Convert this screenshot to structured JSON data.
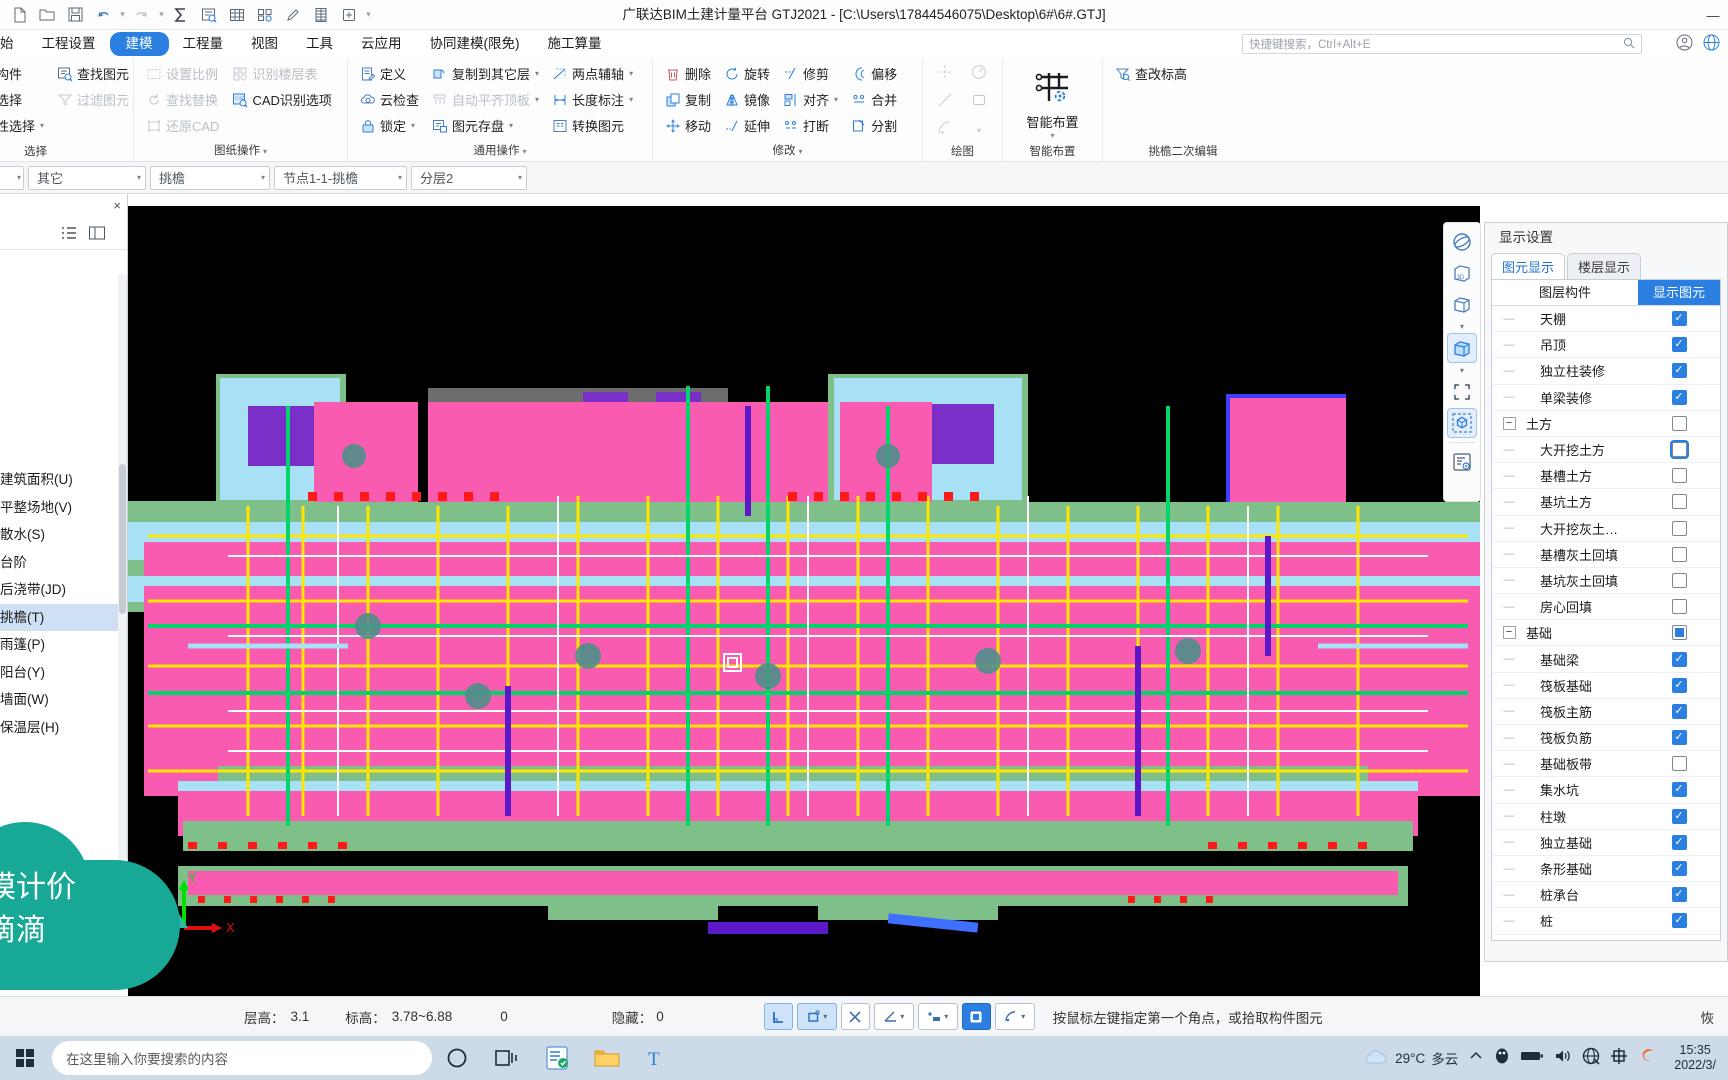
{
  "window": {
    "title": "广联达BIM土建计量平台 GTJ2021 - [C:\\Users\\17844546075\\Desktop\\6#\\6#.GTJ]",
    "minimize": "—",
    "maximize": "▢",
    "close": "✕"
  },
  "quick_access": [
    {
      "name": "new-file-icon",
      "glyph": "new"
    },
    {
      "name": "open-folder-icon",
      "glyph": "open"
    },
    {
      "name": "save-icon",
      "glyph": "save"
    },
    {
      "name": "undo-icon",
      "glyph": "undo"
    },
    {
      "name": "redo-icon",
      "glyph": "redo"
    },
    {
      "name": "sum-icon",
      "glyph": "sum"
    },
    {
      "name": "check-quantity-icon",
      "glyph": "qcheck"
    },
    {
      "name": "table-icon",
      "glyph": "table"
    },
    {
      "name": "report-icon",
      "glyph": "report"
    },
    {
      "name": "pen-icon",
      "glyph": "pen"
    },
    {
      "name": "ruler-icon",
      "glyph": "ruler"
    },
    {
      "name": "add-item-icon",
      "glyph": "additem"
    }
  ],
  "menubar": {
    "items": [
      {
        "label": "始",
        "active": false
      },
      {
        "label": "工程设置",
        "active": false
      },
      {
        "label": "建模",
        "active": true
      },
      {
        "label": "工程量",
        "active": false
      },
      {
        "label": "视图",
        "active": false
      },
      {
        "label": "工具",
        "active": false
      },
      {
        "label": "云应用",
        "active": false
      },
      {
        "label": "协同建模(限免)",
        "active": false
      },
      {
        "label": "施工算量",
        "active": false
      }
    ],
    "search_placeholder": "快捷键搜索，Ctrl+Alt+E"
  },
  "ribbon": {
    "groups": [
      {
        "title": "选择",
        "columns": [
          {
            "items": [
              {
                "label": "拾取构件",
                "icon": "pick-component-icon",
                "disabled": false,
                "caret": false
              },
              {
                "label": "批量选择",
                "icon": "batch-select-icon",
                "disabled": false,
                "caret": false
              },
              {
                "label": "按属性选择",
                "icon": "select-by-attribute-icon",
                "disabled": false,
                "caret": true
              }
            ]
          },
          {
            "items": [
              {
                "label": "查找图元",
                "icon": "find-element-icon",
                "disabled": false,
                "caret": false
              },
              {
                "label": "过滤图元",
                "icon": "filter-element-icon",
                "disabled": true,
                "caret": false
              }
            ]
          }
        ]
      },
      {
        "title": "图纸操作",
        "columns": [
          {
            "items": [
              {
                "label": "设置比例",
                "icon": "set-scale-icon",
                "disabled": true,
                "caret": false
              },
              {
                "label": "查找替换",
                "icon": "find-replace-icon",
                "disabled": true,
                "caret": false
              },
              {
                "label": "还原CAD",
                "icon": "restore-cad-icon",
                "disabled": true,
                "caret": false
              }
            ]
          },
          {
            "items": [
              {
                "label": "识别楼层表",
                "icon": "recognize-floor-table-icon",
                "disabled": true,
                "caret": false
              },
              {
                "label": "CAD识别选项",
                "icon": "cad-recognize-options-icon",
                "disabled": false,
                "caret": false
              }
            ]
          }
        ]
      },
      {
        "title": "通用操作",
        "columns": [
          {
            "items": [
              {
                "label": "定义",
                "icon": "define-icon",
                "disabled": false,
                "caret": false
              },
              {
                "label": "云检查",
                "icon": "cloud-check-icon",
                "disabled": false,
                "caret": false
              },
              {
                "label": "锁定",
                "icon": "lock-icon",
                "disabled": false,
                "caret": true
              }
            ]
          },
          {
            "items": [
              {
                "label": "复制到其它层",
                "icon": "copy-to-other-floor-icon",
                "disabled": false,
                "caret": true
              },
              {
                "label": "自动平齐顶板",
                "icon": "auto-align-slab-icon",
                "disabled": true,
                "caret": true
              },
              {
                "label": "图元存盘",
                "icon": "save-element-icon",
                "disabled": false,
                "caret": true
              }
            ]
          },
          {
            "items": [
              {
                "label": "两点辅轴",
                "icon": "two-point-aux-axis-icon",
                "disabled": false,
                "caret": true
              },
              {
                "label": "长度标注",
                "icon": "length-dimension-icon",
                "disabled": false,
                "caret": true
              },
              {
                "label": "转换图元",
                "icon": "convert-element-icon",
                "disabled": false,
                "caret": false
              }
            ]
          }
        ]
      },
      {
        "title": "修改",
        "columns": [
          {
            "items": [
              {
                "label": "删除",
                "icon": "delete-icon",
                "disabled": false,
                "caret": false
              },
              {
                "label": "复制",
                "icon": "copy-icon",
                "disabled": false,
                "caret": false
              },
              {
                "label": "移动",
                "icon": "move-icon",
                "disabled": false,
                "caret": false
              }
            ]
          },
          {
            "items": [
              {
                "label": "旋转",
                "icon": "rotate-icon",
                "disabled": false,
                "caret": false
              },
              {
                "label": "镜像",
                "icon": "mirror-icon",
                "disabled": false,
                "caret": false
              },
              {
                "label": "延伸",
                "icon": "extend-icon",
                "disabled": false,
                "caret": false
              }
            ]
          },
          {
            "items": [
              {
                "label": "修剪",
                "icon": "trim-icon",
                "disabled": false,
                "caret": false
              },
              {
                "label": "对齐",
                "icon": "align-icon",
                "disabled": false,
                "caret": true
              },
              {
                "label": "打断",
                "icon": "break-icon",
                "disabled": false,
                "caret": false
              }
            ]
          },
          {
            "items": [
              {
                "label": "偏移",
                "icon": "offset-icon",
                "disabled": false,
                "caret": false
              },
              {
                "label": "合并",
                "icon": "merge-icon",
                "disabled": false,
                "caret": false
              },
              {
                "label": "分割",
                "icon": "split-icon",
                "disabled": false,
                "caret": false
              }
            ]
          }
        ]
      },
      {
        "title": "绘图",
        "draw_tools": [
          {
            "name": "point-tool-icon"
          },
          {
            "name": "circle-tool-icon"
          },
          {
            "name": "line-tool-icon"
          },
          {
            "name": "rect-tool-icon"
          },
          {
            "name": "arc-tool-icon"
          },
          {
            "name": "arc-more-caret-icon"
          }
        ]
      },
      {
        "title": "智能布置",
        "big_button": {
          "label": "智能布置",
          "icon": "smart-layout-icon",
          "caret": "▾"
        }
      },
      {
        "title": "挑檐二次编辑",
        "columns": [
          {
            "items": [
              {
                "label": "查改标高",
                "icon": "check-modify-elevation-icon",
                "disabled": false,
                "caret": false
              }
            ]
          }
        ]
      }
    ]
  },
  "subbar": {
    "combos": [
      {
        "name": "combo-blank",
        "value": ""
      },
      {
        "name": "combo-category",
        "value": "其它"
      },
      {
        "name": "combo-component-type",
        "value": "挑檐"
      },
      {
        "name": "combo-component",
        "value": "节点1-1-挑檐"
      },
      {
        "name": "combo-layer",
        "value": "分层2"
      }
    ]
  },
  "left_panel": {
    "close_label": "×",
    "tools": [
      "list-view-icon",
      "detail-view-icon"
    ],
    "items": [
      {
        "label": "建筑面积(U)",
        "selected": false
      },
      {
        "label": "平整场地(V)",
        "selected": false
      },
      {
        "label": "散水(S)",
        "selected": false
      },
      {
        "label": "台阶",
        "selected": false
      },
      {
        "label": "后浇带(JD)",
        "selected": false
      },
      {
        "label": "挑檐(T)",
        "selected": true
      },
      {
        "label": "雨篷(P)",
        "selected": false
      },
      {
        "label": "阳台(Y)",
        "selected": false
      },
      {
        "label": "墙面(W)",
        "selected": false
      },
      {
        "label": "保温层(H)",
        "selected": false
      }
    ]
  },
  "canvas": {
    "axis_x_label": "X",
    "axis_y_label": "Y"
  },
  "view_toolstrip": [
    {
      "name": "orbit-icon",
      "active": false,
      "caret": false
    },
    {
      "name": "three-d-view-icon",
      "active": false,
      "caret": false
    },
    {
      "name": "wireframe-box-icon",
      "active": false,
      "caret": true
    },
    {
      "name": "solid-box-icon",
      "active": true,
      "caret": true
    },
    {
      "name": "zoom-fit-icon",
      "active": false,
      "caret": false
    },
    {
      "name": "section-box-icon",
      "active": true,
      "caret": false
    },
    {
      "name": "display-settings-icon",
      "active": false,
      "caret": false
    }
  ],
  "right_panel": {
    "title": "显示设置",
    "tabs": [
      {
        "label": "图元显示",
        "active": true
      },
      {
        "label": "楼层显示",
        "active": false
      }
    ],
    "header": {
      "layer": "图层构件",
      "show": "显示图元"
    },
    "rows": [
      {
        "label": "天棚",
        "type": "leaf",
        "state": "checked"
      },
      {
        "label": "吊顶",
        "type": "leaf",
        "state": "checked"
      },
      {
        "label": "独立柱装修",
        "type": "leaf",
        "state": "checked"
      },
      {
        "label": "单梁装修",
        "type": "leaf",
        "state": "checked"
      },
      {
        "label": "土方",
        "type": "group",
        "state": "unchecked"
      },
      {
        "label": "大开挖土方",
        "type": "leaf",
        "state": "unchecked-highlight"
      },
      {
        "label": "基槽土方",
        "type": "leaf",
        "state": "unchecked"
      },
      {
        "label": "基坑土方",
        "type": "leaf",
        "state": "unchecked"
      },
      {
        "label": "大开挖灰土…",
        "type": "leaf",
        "state": "unchecked"
      },
      {
        "label": "基槽灰土回填",
        "type": "leaf",
        "state": "unchecked"
      },
      {
        "label": "基坑灰土回填",
        "type": "leaf",
        "state": "unchecked"
      },
      {
        "label": "房心回填",
        "type": "leaf",
        "state": "unchecked"
      },
      {
        "label": "基础",
        "type": "group",
        "state": "partial"
      },
      {
        "label": "基础梁",
        "type": "leaf",
        "state": "checked"
      },
      {
        "label": "筏板基础",
        "type": "leaf",
        "state": "checked"
      },
      {
        "label": "筏板主筋",
        "type": "leaf",
        "state": "checked"
      },
      {
        "label": "筏板负筋",
        "type": "leaf",
        "state": "checked"
      },
      {
        "label": "基础板带",
        "type": "leaf",
        "state": "unchecked"
      },
      {
        "label": "集水坑",
        "type": "leaf",
        "state": "checked"
      },
      {
        "label": "柱墩",
        "type": "leaf",
        "state": "checked"
      },
      {
        "label": "独立基础",
        "type": "leaf",
        "state": "checked"
      },
      {
        "label": "条形基础",
        "type": "leaf",
        "state": "checked"
      },
      {
        "label": "桩承台",
        "type": "leaf",
        "state": "checked"
      },
      {
        "label": "桩",
        "type": "leaf",
        "state": "checked"
      }
    ]
  },
  "statusbar": {
    "floor_height_label": "层高：",
    "floor_height_value": "3.1",
    "elevation_label": "标高：",
    "elevation_value": "3.78~6.88",
    "extra_value": "0",
    "hidden_label": "隐藏：",
    "hidden_value": "0",
    "tools": [
      {
        "name": "ortho-snap-button",
        "glyph": "⌐",
        "state": "on",
        "caret": false
      },
      {
        "name": "object-snap-button",
        "glyph": "▢",
        "state": "on",
        "caret": true
      },
      {
        "name": "intersection-snap-button",
        "glyph": "✕",
        "state": "off",
        "caret": false
      },
      {
        "name": "angle-snap-button",
        "glyph": "∠",
        "state": "off",
        "caret": true
      },
      {
        "name": "dimension-snap-button",
        "glyph": "+▬",
        "state": "off",
        "caret": true
      },
      {
        "name": "dynamic-input-button",
        "glyph": "▣",
        "state": "blue",
        "caret": false
      },
      {
        "name": "polyline-button",
        "glyph": "◠",
        "state": "off",
        "caret": true
      }
    ],
    "hint": "按鼠标左键指定第一个角点，或拾取构件图元",
    "restore_label": "恢"
  },
  "watermark": {
    "line1": "模计价",
    "line2": "滴滴"
  },
  "taskbar": {
    "search_placeholder": "在这里输入你要搜索的内容",
    "icons": [
      {
        "name": "cortana-circle-icon"
      },
      {
        "name": "task-view-icon"
      },
      {
        "name": "app-green-icon"
      },
      {
        "name": "file-explorer-icon"
      },
      {
        "name": "app-blue-t-icon"
      }
    ],
    "weather": {
      "temp": "29°C",
      "desc": "多云"
    },
    "tray": [
      {
        "name": "chevron-up-icon"
      },
      {
        "name": "qq-penguin-icon"
      },
      {
        "name": "battery-icon"
      },
      {
        "name": "volume-icon"
      },
      {
        "name": "network-disconnected-icon"
      },
      {
        "name": "ime-chinese-icon"
      },
      {
        "name": "sogou-input-icon"
      }
    ],
    "clock": {
      "time": "15:35",
      "date": "2022/3/"
    }
  }
}
